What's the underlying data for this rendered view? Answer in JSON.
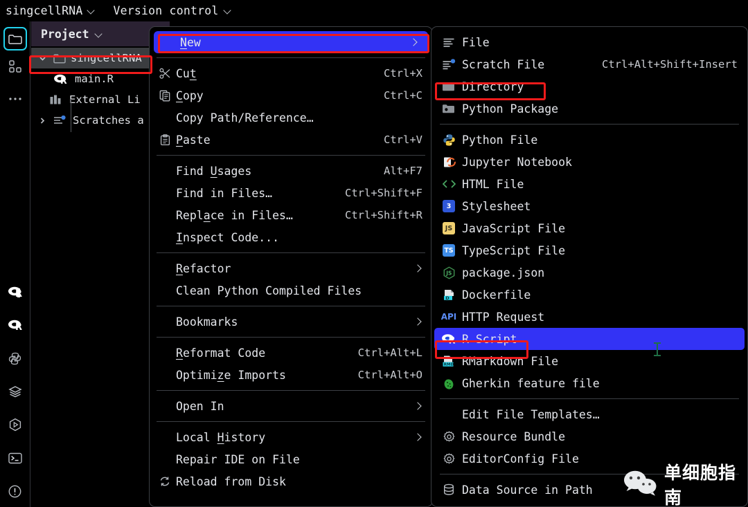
{
  "topbar": {
    "project_name": "singcellRNA",
    "version_control": "Version control"
  },
  "rail": {
    "items": [
      {
        "name": "project-folder",
        "icon": "folder-icon",
        "selected": true
      },
      {
        "name": "structure",
        "icon": "blocks-icon",
        "selected": false
      },
      {
        "name": "more",
        "icon": "ellipsis-icon",
        "selected": false
      },
      {
        "name": "r-console-1",
        "icon": "r-logo-icon",
        "selected": false
      },
      {
        "name": "r-console-2",
        "icon": "r-logo-icon",
        "selected": false
      },
      {
        "name": "python-console",
        "icon": "python-icon",
        "selected": false
      },
      {
        "name": "database",
        "icon": "layers-icon",
        "selected": false
      },
      {
        "name": "run",
        "icon": "run-hexagon-icon",
        "selected": false
      },
      {
        "name": "terminal",
        "icon": "terminal-icon",
        "selected": false
      },
      {
        "name": "problems",
        "icon": "warning-circle-icon",
        "selected": false
      }
    ]
  },
  "project_panel": {
    "title": "Project",
    "tree": [
      {
        "label": "singcellRNA",
        "icon": "folder-icon",
        "selected": true,
        "expanded": true,
        "depth": 0,
        "highlighted": true
      },
      {
        "label": "main.R",
        "icon": "r-file-icon",
        "selected": false,
        "depth": 1
      },
      {
        "label": "External Li",
        "icon": "library-icon",
        "selected": false,
        "depth": 0
      },
      {
        "label": "Scratches a",
        "icon": "scratch-icon",
        "selected": false,
        "depth": 0,
        "collapsed": true
      }
    ]
  },
  "context_menu": {
    "items": [
      {
        "label": "New",
        "icon": "",
        "shortcut": "",
        "submenu": true,
        "highlighted": true,
        "redbox": true,
        "mnemonic": "N"
      },
      {
        "type": "separator"
      },
      {
        "label": "Cut",
        "icon": "scissors-icon",
        "shortcut": "Ctrl+X",
        "mnemonic": "t"
      },
      {
        "label": "Copy",
        "icon": "copy-icon",
        "shortcut": "Ctrl+C",
        "mnemonic": "C"
      },
      {
        "label": "Copy Path/Reference…",
        "icon": "",
        "shortcut": ""
      },
      {
        "label": "Paste",
        "icon": "paste-icon",
        "shortcut": "Ctrl+V",
        "mnemonic": "P"
      },
      {
        "type": "separator"
      },
      {
        "label": "Find Usages",
        "icon": "",
        "shortcut": "Alt+F7",
        "mnemonic": "U"
      },
      {
        "label": "Find in Files…",
        "icon": "",
        "shortcut": "Ctrl+Shift+F"
      },
      {
        "label": "Replace in Files…",
        "icon": "",
        "shortcut": "Ctrl+Shift+R",
        "mnemonic": "a"
      },
      {
        "label": "Inspect Code...",
        "icon": "",
        "shortcut": "",
        "mnemonic": "I"
      },
      {
        "type": "separator"
      },
      {
        "label": "Refactor",
        "icon": "",
        "shortcut": "",
        "submenu": true,
        "mnemonic": "R"
      },
      {
        "label": "Clean Python Compiled Files",
        "icon": "",
        "shortcut": ""
      },
      {
        "type": "separator"
      },
      {
        "label": "Bookmarks",
        "icon": "",
        "shortcut": "",
        "submenu": true
      },
      {
        "type": "separator"
      },
      {
        "label": "Reformat Code",
        "icon": "",
        "shortcut": "Ctrl+Alt+L",
        "mnemonic": "R"
      },
      {
        "label": "Optimize Imports",
        "icon": "",
        "shortcut": "Ctrl+Alt+O",
        "mnemonic": "z"
      },
      {
        "type": "separator"
      },
      {
        "label": "Open In",
        "icon": "",
        "shortcut": "",
        "submenu": true
      },
      {
        "type": "separator"
      },
      {
        "label": "Local History",
        "icon": "",
        "shortcut": "",
        "submenu": true,
        "mnemonic": "H"
      },
      {
        "label": "Repair IDE on File",
        "icon": "",
        "shortcut": ""
      },
      {
        "label": "Reload from Disk",
        "icon": "reload-icon",
        "shortcut": ""
      }
    ]
  },
  "submenu": {
    "items": [
      {
        "label": "File",
        "icon": "file-lines-icon",
        "shortcut": ""
      },
      {
        "label": "Scratch File",
        "icon": "scratch-file-icon",
        "shortcut": "Ctrl+Alt+Shift+Insert"
      },
      {
        "label": "Directory",
        "icon": "folder-icon",
        "shortcut": "",
        "redbox": true
      },
      {
        "label": "Python Package",
        "icon": "python-package-icon",
        "shortcut": ""
      },
      {
        "type": "separator"
      },
      {
        "label": "Python File",
        "icon": "python-icon",
        "shortcut": ""
      },
      {
        "label": "Jupyter Notebook",
        "icon": "jupyter-icon",
        "shortcut": ""
      },
      {
        "label": "HTML File",
        "icon": "html-icon",
        "shortcut": ""
      },
      {
        "label": "Stylesheet",
        "icon": "css-icon",
        "shortcut": ""
      },
      {
        "label": "JavaScript File",
        "icon": "js-icon",
        "shortcut": ""
      },
      {
        "label": "TypeScript File",
        "icon": "ts-icon",
        "shortcut": ""
      },
      {
        "label": "package.json",
        "icon": "nodejs-icon",
        "shortcut": ""
      },
      {
        "label": "Dockerfile",
        "icon": "docker-icon",
        "shortcut": ""
      },
      {
        "label": "HTTP Request",
        "icon": "api-icon",
        "shortcut": ""
      },
      {
        "label": "R Script",
        "icon": "r-logo-icon",
        "shortcut": "",
        "highlighted": true,
        "redbox": true
      },
      {
        "label": "RMarkdown File",
        "icon": "rmd-icon",
        "shortcut": ""
      },
      {
        "label": "Gherkin feature file",
        "icon": "cucumber-icon",
        "shortcut": ""
      },
      {
        "type": "separator"
      },
      {
        "label": "Edit File Templates…",
        "icon": "",
        "shortcut": ""
      },
      {
        "label": "Resource Bundle",
        "icon": "gear-icon",
        "shortcut": ""
      },
      {
        "label": "EditorConfig File",
        "icon": "gear-icon",
        "shortcut": ""
      },
      {
        "type": "separator"
      },
      {
        "label": "Data Source in Path",
        "icon": "database-icon",
        "shortcut": ""
      }
    ]
  },
  "watermark": {
    "text": "单细胞指南",
    "icon": "wechat-icon"
  },
  "colors": {
    "highlight_blue": "#3333f5",
    "annotation_red": "#ef1b1b",
    "selected_cyan": "#22d3ee",
    "panel_bg": "#000000",
    "project_header_bg": "#2b2233",
    "border": "#3c3f44"
  }
}
